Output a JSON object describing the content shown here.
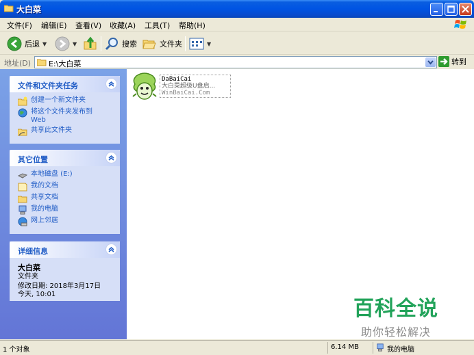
{
  "window": {
    "title": "大白菜"
  },
  "menu": [
    "文件(F)",
    "编辑(E)",
    "查看(V)",
    "收藏(A)",
    "工具(T)",
    "帮助(H)"
  ],
  "toolbar": {
    "back": "后退",
    "search": "搜索",
    "folders": "文件夹"
  },
  "address": {
    "label": "地址(D)",
    "path": "E:\\大白菜",
    "go": "转到"
  },
  "tasks_panel": {
    "title": "文件和文件夹任务",
    "items": [
      {
        "label": "创建一个新文件夹",
        "icon": "new-folder-icon"
      },
      {
        "label": "将这个文件夹发布到 Web",
        "icon": "publish-web-icon"
      },
      {
        "label": "共享此文件夹",
        "icon": "share-folder-icon"
      }
    ]
  },
  "places_panel": {
    "title": "其它位置",
    "items": [
      {
        "label": "本地磁盘 (E:)",
        "icon": "local-disk-icon"
      },
      {
        "label": "我的文档",
        "icon": "my-documents-icon"
      },
      {
        "label": "共享文档",
        "icon": "shared-documents-icon"
      },
      {
        "label": "我的电脑",
        "icon": "my-computer-icon"
      },
      {
        "label": "网上邻居",
        "icon": "network-icon"
      }
    ]
  },
  "details_panel": {
    "title": "详细信息",
    "name": "大白菜",
    "type": "文件夹",
    "modified": "修改日期: 2018年3月17日",
    "time": "今天, 10:01"
  },
  "file": {
    "line1": "DaBaiCai",
    "line2": "大白菜超级U盘启...",
    "line3": "WinBaiCai.Com"
  },
  "watermark": {
    "main": "百科全说",
    "sub": "助你轻松解决"
  },
  "status": {
    "objects": "1 个对象",
    "size": "6.14 MB",
    "location": "我的电脑"
  },
  "colors": {
    "title_blue": "#0054e3",
    "task_blue": "#215dc6",
    "watermark_green": "#22a35a"
  }
}
